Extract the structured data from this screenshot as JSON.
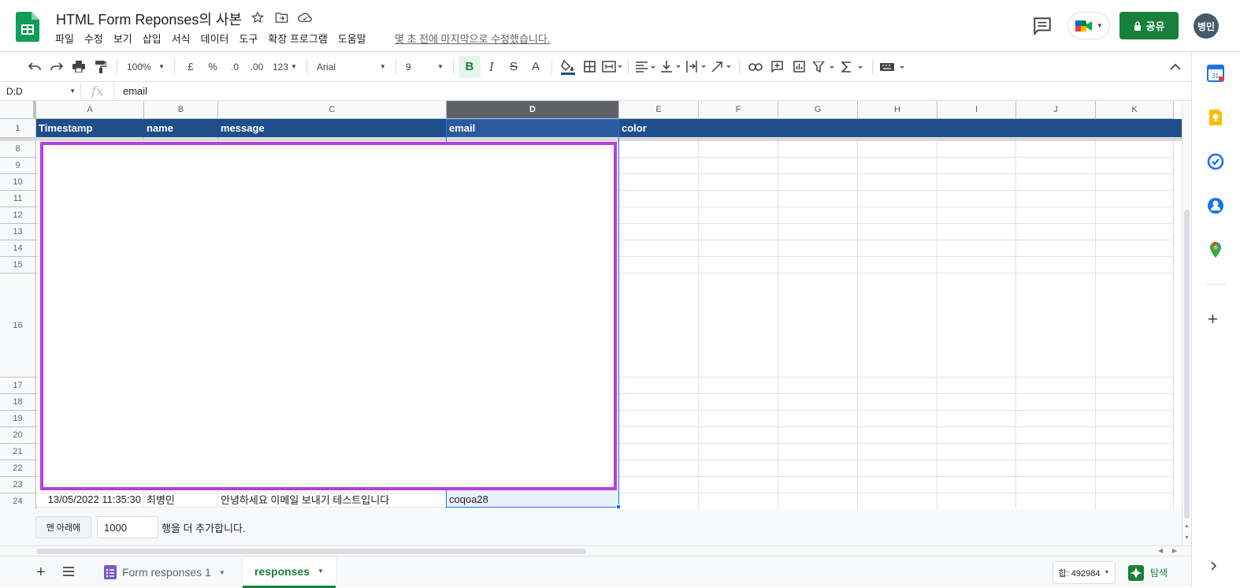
{
  "header": {
    "doc_title": "HTML Form Reponses의 사본",
    "menu": [
      "파일",
      "수정",
      "보기",
      "삽입",
      "서식",
      "데이터",
      "도구",
      "확장 프로그램",
      "도움말"
    ],
    "last_edit": "몇 초 전에 마지막으로 수정했습니다.",
    "share_label": "공유",
    "avatar_initials": "병민",
    "share_color": "#188038"
  },
  "toolbar": {
    "zoom": "100%",
    "currency": "£",
    "percent": "%",
    "dec_decrease": ".0",
    "dec_increase": ".00",
    "number_format": "123",
    "font": "Arial",
    "font_size": "9",
    "bold": "B",
    "italic": "I",
    "strike": "S",
    "text_color": "A"
  },
  "formula_bar": {
    "name_box": "D:D",
    "fx": "fx",
    "value": "email"
  },
  "grid": {
    "columns": [
      "A",
      "B",
      "C",
      "D",
      "E",
      "F",
      "G",
      "H",
      "I",
      "J",
      "K"
    ],
    "selected_column": "D",
    "header_row_number": "1",
    "header_cells": [
      "Timestamp",
      "name",
      "message",
      "email",
      "color"
    ],
    "row_numbers": [
      "8",
      "9",
      "10",
      "11",
      "12",
      "13",
      "14",
      "15",
      "16",
      "17",
      "18",
      "19",
      "20",
      "21",
      "22",
      "23",
      "24"
    ],
    "row24": {
      "timestamp": "13/05/2022 11:35:30",
      "name": "최병민",
      "message": "안녕하세요 이메일 보내기 테스트입니다",
      "email": "coqoa28"
    },
    "header_fill": "#1f4e8c",
    "overlay_border": "#b63ee0"
  },
  "add_rows": {
    "button": "맨 아래에",
    "count": "1000",
    "suffix": "행을 더 추가합니다."
  },
  "sheets": {
    "tabs": [
      {
        "label": "Form responses 1"
      },
      {
        "label": "responses"
      }
    ],
    "active": "responses",
    "sum": "합: 492984",
    "explore": "탐색"
  },
  "side_panel": {
    "icons": [
      "calendar-icon",
      "keep-icon",
      "tasks-icon",
      "contacts-icon",
      "maps-icon",
      "add-icon"
    ]
  }
}
